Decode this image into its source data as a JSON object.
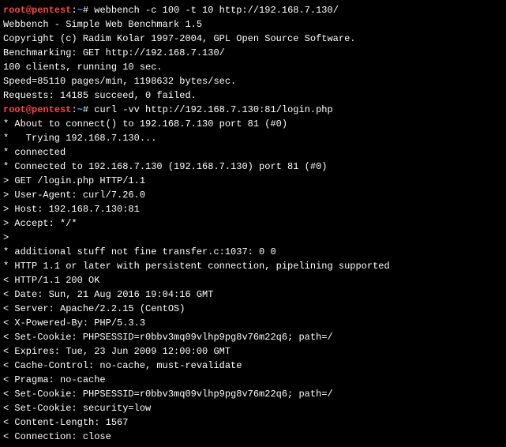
{
  "prompt1": {
    "user": "root",
    "at": "@",
    "host": "pentest",
    "colon": ":",
    "path": "~",
    "hash": "# ",
    "command": "webbench -c 100 -t 10 http://192.168.7.130/"
  },
  "output1": [
    "Webbench - Simple Web Benchmark 1.5",
    "Copyright (c) Radim Kolar 1997-2004, GPL Open Source Software.",
    "",
    "Benchmarking: GET http://192.168.7.130/",
    "100 clients, running 10 sec.",
    "",
    "Speed=85110 pages/min, 1198632 bytes/sec.",
    "Requests: 14185 succeed, 0 failed."
  ],
  "prompt2": {
    "user": "root",
    "at": "@",
    "host": "pentest",
    "colon": ":",
    "path": "~",
    "hash": "# ",
    "command": "curl -vv http://192.168.7.130:81/login.php"
  },
  "output2": [
    "* About to connect() to 192.168.7.130 port 81 (#0)",
    "*   Trying 192.168.7.130...",
    "* connected",
    "* Connected to 192.168.7.130 (192.168.7.130) port 81 (#0)",
    "> GET /login.php HTTP/1.1",
    "> User-Agent: curl/7.26.0",
    "> Host: 192.168.7.130:81",
    "> Accept: */*",
    ">",
    "* additional stuff not fine transfer.c:1037: 0 0",
    "* HTTP 1.1 or later with persistent connection, pipelining supported",
    "< HTTP/1.1 200 OK",
    "< Date: Sun, 21 Aug 2016 19:04:16 GMT",
    "< Server: Apache/2.2.15 (CentOS)",
    "< X-Powered-By: PHP/5.3.3",
    "< Set-Cookie: PHPSESSID=r0bbv3mq09vlhp9pg8v76m22q6; path=/",
    "< Expires: Tue, 23 Jun 2009 12:00:00 GMT",
    "< Cache-Control: no-cache, must-revalidate",
    "< Pragma: no-cache",
    "< Set-Cookie: PHPSESSID=r0bbv3mq09vlhp9pg8v76m22q6; path=/",
    "< Set-Cookie: security=low",
    "< Content-Length: 1567",
    "< Connection: close"
  ]
}
